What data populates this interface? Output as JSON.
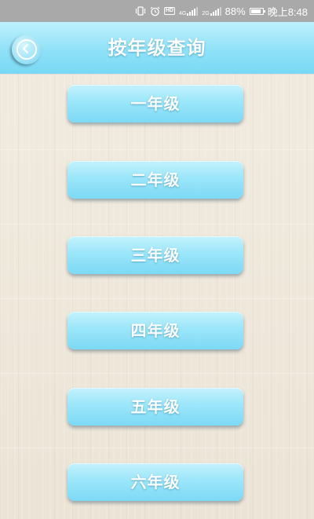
{
  "status_bar": {
    "battery_percent": "88%",
    "time": "晚上8:48",
    "network_label_1": "4G",
    "network_label_2": "2G",
    "hd_label": "HD",
    "battery_level": 0.88
  },
  "header": {
    "title": "按年级查询"
  },
  "grades": [
    {
      "label": "一年级"
    },
    {
      "label": "二年级"
    },
    {
      "label": "三年级"
    },
    {
      "label": "四年级"
    },
    {
      "label": "五年级"
    },
    {
      "label": "六年级"
    }
  ],
  "colors": {
    "header_accent": "#8fe1f8",
    "button_accent": "#9be6fa",
    "background": "#efe7da"
  }
}
